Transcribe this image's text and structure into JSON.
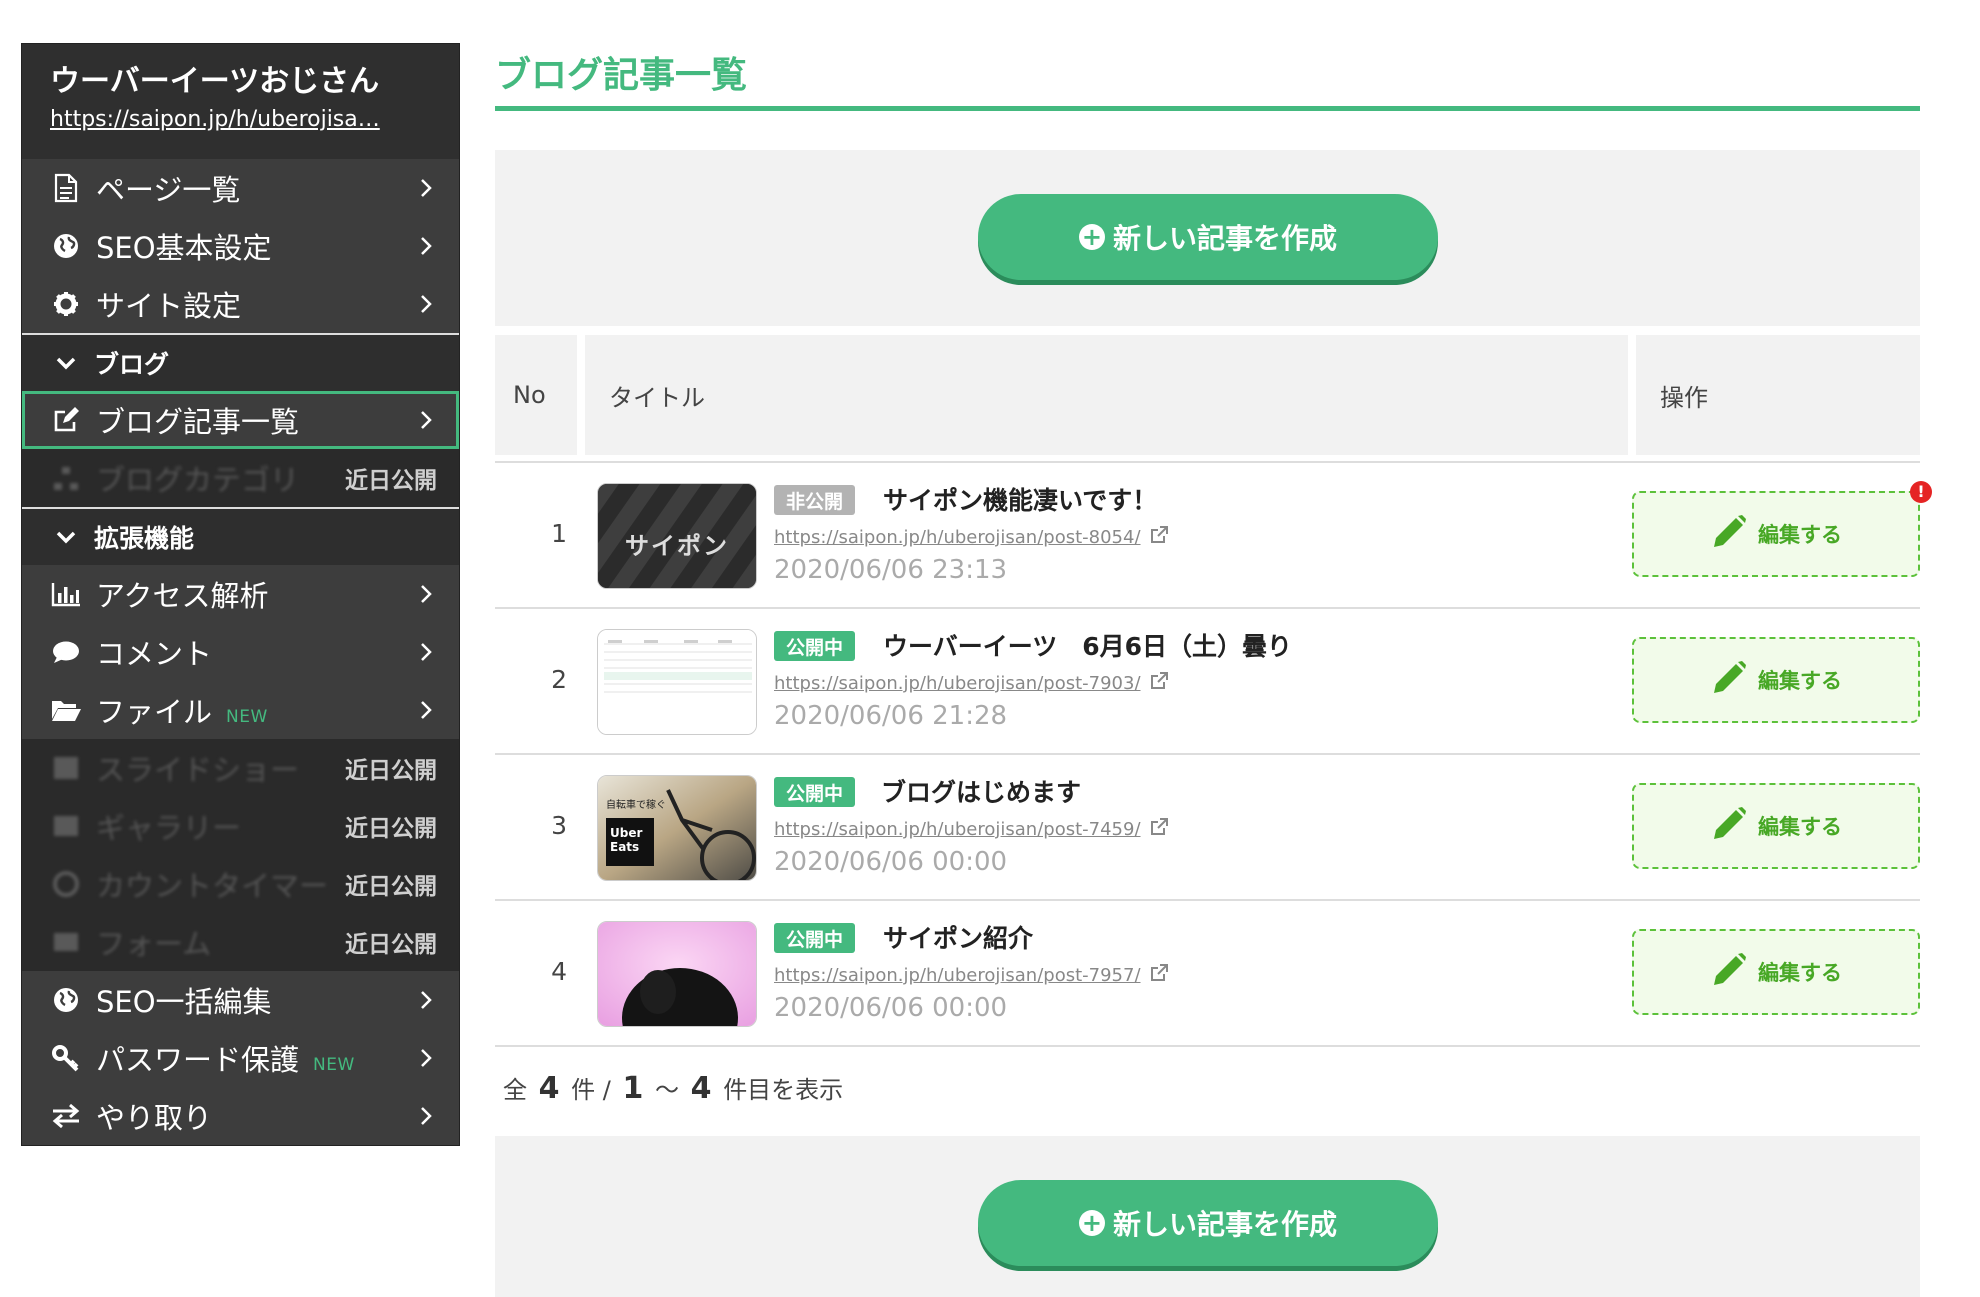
{
  "site": {
    "name": "ウーバーイーツおじさん",
    "url": "https://saipon.jp/h/uberojisa…"
  },
  "sidebar": {
    "items_top": [
      {
        "label": "ページ一覧",
        "icon": "document-icon"
      },
      {
        "label": "SEO基本設定",
        "icon": "globe-icon"
      },
      {
        "label": "サイト設定",
        "icon": "gear-icon"
      }
    ],
    "blog_section": "ブログ",
    "blog_items": [
      {
        "label": "ブログ記事一覧",
        "icon": "edit-icon",
        "active": true
      },
      {
        "label": "ブログカテゴリ",
        "icon": "sitemap-icon",
        "tag": "近日公開"
      }
    ],
    "ext_section": "拡張機能",
    "ext_items": [
      {
        "label": "アクセス解析",
        "icon": "bar-chart-icon"
      },
      {
        "label": "コメント",
        "icon": "comment-icon"
      },
      {
        "label": "ファイル",
        "icon": "folder-open-icon",
        "new": "NEW"
      },
      {
        "label": "スライドショー",
        "icon": "film-icon",
        "tag": "近日公開"
      },
      {
        "label": "ギャラリー",
        "icon": "image-icon",
        "tag": "近日公開"
      },
      {
        "label": "カウントタイマー",
        "icon": "clock-icon",
        "tag": "近日公開"
      },
      {
        "label": "フォーム",
        "icon": "form-icon",
        "tag": "近日公開"
      },
      {
        "label": "SEO一括編集",
        "icon": "globe-icon"
      },
      {
        "label": "パスワード保護",
        "icon": "key-icon",
        "new": "NEW"
      },
      {
        "label": "やり取り",
        "icon": "exchange-icon"
      }
    ]
  },
  "main": {
    "title": "ブログ記事一覧",
    "create_label": "新しい記事を作成",
    "columns": {
      "no": "No",
      "title": "タイトル",
      "ops": "操作"
    },
    "edit_label": "編集する",
    "posts": [
      {
        "no": "1",
        "status": "非公開",
        "title": "サイポン機能凄いです！",
        "url": "https://saipon.jp/h/uberojisan/post-8054/",
        "date": "2020/06/06  23:13",
        "thumb_text": "サイポン"
      },
      {
        "no": "2",
        "status": "公開中",
        "title": "ウーバーイーツ　6月6日（土）曇り",
        "url": "https://saipon.jp/h/uberojisan/post-7903/",
        "date": "2020/06/06  21:28"
      },
      {
        "no": "3",
        "status": "公開中",
        "title": "ブログはじめます",
        "url": "https://saipon.jp/h/uberojisan/post-7459/",
        "date": "2020/06/06  00:00",
        "thumb_text": "Uber Eats",
        "thumb_caption": "自転車で稼ぐ"
      },
      {
        "no": "4",
        "status": "公開中",
        "title": "サイポン紹介",
        "url": "https://saipon.jp/h/uberojisan/post-7957/",
        "date": "2020/06/06  00:00"
      }
    ],
    "summary": {
      "prefix": "全",
      "total": "4",
      "mid1": "件 /",
      "from": "1",
      "tilde": "～",
      "to": "4",
      "suffix": "件目を表示"
    }
  },
  "colors": {
    "accent": "#44b97f",
    "sidebar": "#3d3d3d",
    "edit": "#5cc13a",
    "alert": "#e52424"
  }
}
